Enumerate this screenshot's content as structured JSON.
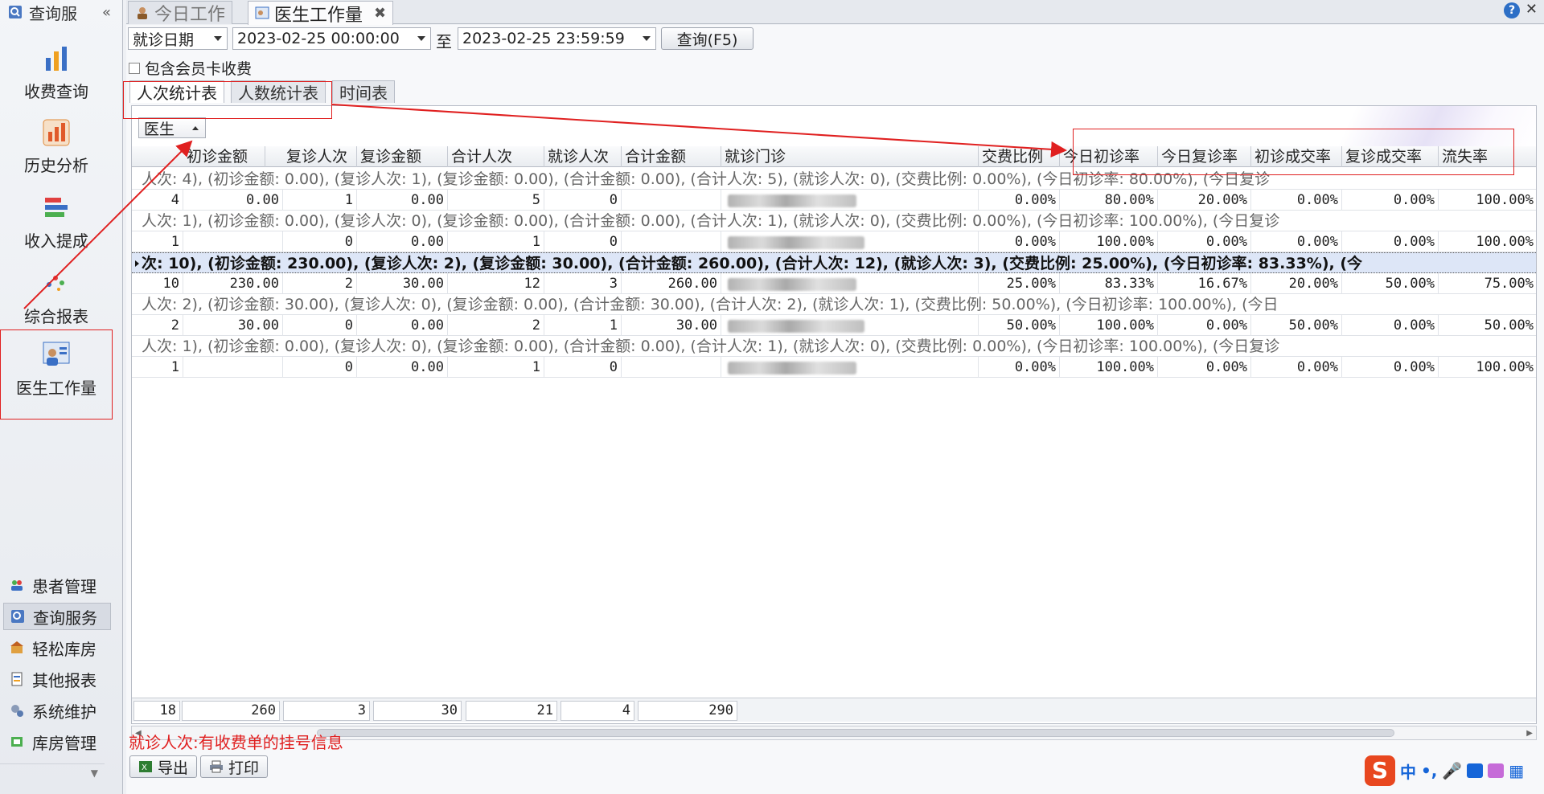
{
  "sidebar": {
    "header_title": "查询服",
    "big_items": [
      {
        "label": "收费查询",
        "icon": "bar-chart-icon"
      },
      {
        "label": "历史分析",
        "icon": "history-chart-icon"
      },
      {
        "label": "收入提成",
        "icon": "stacked-bars-icon"
      },
      {
        "label": "综合报表",
        "icon": "scatter-icon"
      },
      {
        "label": "医生工作量",
        "icon": "doctor-workload-icon",
        "active": true
      }
    ],
    "small_items": [
      {
        "label": "患者管理",
        "icon": "patients-icon"
      },
      {
        "label": "查询服务",
        "icon": "query-service-icon",
        "active": true
      },
      {
        "label": "轻松库房",
        "icon": "warehouse-icon"
      },
      {
        "label": "其他报表",
        "icon": "other-report-icon"
      },
      {
        "label": "系统维护",
        "icon": "maintenance-icon"
      },
      {
        "label": "库房管理",
        "icon": "storage-icon"
      }
    ]
  },
  "tabs": [
    {
      "label": "今日工作",
      "active": false
    },
    {
      "label": "医生工作量",
      "active": true
    }
  ],
  "filters": {
    "date_type": "就诊日期",
    "start": "2023-02-25 00:00:00",
    "to_label": "至",
    "end": "2023-02-25 23:59:59",
    "query_label": "查询(F5)",
    "checkbox_label": "包含会员卡收费"
  },
  "inner_tabs": [
    "人次统计表",
    "人数统计表",
    "时间表"
  ],
  "grid": {
    "group_chip": "医生",
    "columns": [
      "初诊金额",
      "复诊人次",
      "复诊金额",
      "合计人次",
      "就诊人次",
      "合计金额",
      "就诊门诊",
      "交费比例",
      "今日初诊率",
      "今日复诊率",
      "初诊成交率",
      "复诊成交率",
      "流失率"
    ],
    "group_rows": [
      "人次: 4), (初诊金额: 0.00), (复诊人次: 1), (复诊金额: 0.00), (合计金额: 0.00), (合计人次: 5), (就诊人次: 0), (交费比例: 0.00%), (今日初诊率: 80.00%), (今日复诊",
      "人次: 1), (初诊金额: 0.00), (复诊人次: 0), (复诊金额: 0.00), (合计金额: 0.00), (合计人次: 1), (就诊人次: 0), (交费比例: 0.00%), (今日初诊率: 100.00%), (今日复诊",
      "次: 10), (初诊金额: 230.00), (复诊人次: 2), (复诊金额: 30.00), (合计金额: 260.00), (合计人次: 12), (就诊人次: 3), (交费比例: 25.00%), (今日初诊率: 83.33%), (今",
      "人次: 2), (初诊金额: 30.00), (复诊人次: 0), (复诊金额: 0.00), (合计金额: 30.00), (合计人次: 2), (就诊人次: 1), (交费比例: 50.00%), (今日初诊率: 100.00%), (今日",
      "人次: 1), (初诊金额: 0.00), (复诊人次: 0), (复诊金额: 0.00), (合计金额: 0.00), (合计人次: 1), (就诊人次: 0), (交费比例: 0.00%), (今日初诊率: 100.00%), (今日复诊"
    ],
    "data_rows": [
      [
        "4",
        "0.00",
        "1",
        "0.00",
        "5",
        "0",
        "",
        "",
        "0.00%",
        "80.00%",
        "20.00%",
        "0.00%",
        "0.00%",
        "100.00%"
      ],
      [
        "1",
        "",
        "0",
        "0.00",
        "1",
        "0",
        "",
        "",
        "0.00%",
        "100.00%",
        "0.00%",
        "0.00%",
        "0.00%",
        "100.00%"
      ],
      [
        "10",
        "230.00",
        "2",
        "30.00",
        "12",
        "3",
        "260.00",
        "",
        "25.00%",
        "83.33%",
        "16.67%",
        "20.00%",
        "50.00%",
        "75.00%"
      ],
      [
        "2",
        "30.00",
        "0",
        "0.00",
        "2",
        "1",
        "30.00",
        "",
        "50.00%",
        "100.00%",
        "0.00%",
        "50.00%",
        "0.00%",
        "50.00%"
      ],
      [
        "1",
        "",
        "0",
        "0.00",
        "1",
        "0",
        "",
        "",
        "0.00%",
        "100.00%",
        "0.00%",
        "0.00%",
        "0.00%",
        "100.00%"
      ]
    ],
    "selected_group_index": 2,
    "totals": [
      "18",
      "260",
      "3",
      "30",
      "21",
      "4",
      "290"
    ]
  },
  "note": "就诊人次:有收费单的挂号信息",
  "bottom_buttons": [
    "导出",
    "打印"
  ],
  "ime": {
    "logo": "S",
    "mode": "中"
  },
  "colors": {
    "annotation": "#e02020",
    "selected_row": "#dde6f7",
    "note": "#e02020"
  }
}
